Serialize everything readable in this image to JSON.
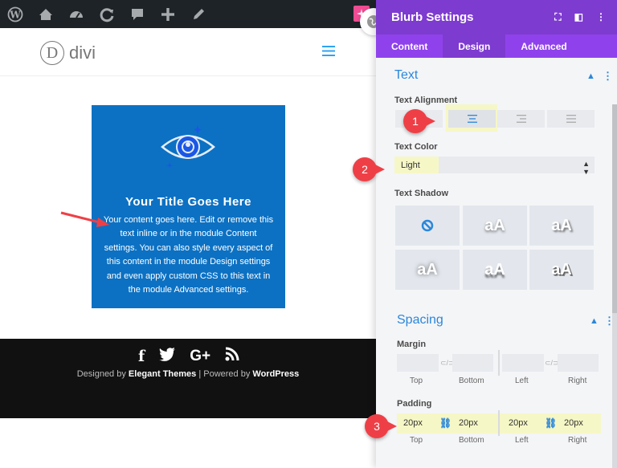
{
  "site": {
    "logo_letter": "D",
    "logo_text": "divi"
  },
  "blurb": {
    "title": "Your Title Goes Here",
    "body": "Your content goes here. Edit or remove this text inline or in the module Content settings. You can also style every aspect of this content in the module Design settings and even apply custom CSS to this text in the module Advanced settings."
  },
  "footer": {
    "social": [
      "f",
      "t",
      "G+",
      "rss"
    ],
    "credits_prefix": "Designed by ",
    "credits_brand": "Elegant Themes",
    "credits_mid": " | Powered by ",
    "credits_wp": "WordPress"
  },
  "panel": {
    "title": "Blurb Settings",
    "tabs": [
      "Content",
      "Design",
      "Advanced"
    ],
    "active_tab": "Design",
    "text_section": {
      "title": "Text",
      "alignment_label": "Text Alignment",
      "color_label": "Text Color",
      "color_value": "Light",
      "shadow_label": "Text Shadow",
      "shadow_preview": "aA"
    },
    "spacing_section": {
      "title": "Spacing",
      "margin_label": "Margin",
      "padding_label": "Padding",
      "side_labels": [
        "Top",
        "Bottom",
        "Left",
        "Right"
      ],
      "padding_values": [
        "20px",
        "20px",
        "20px",
        "20px"
      ]
    }
  },
  "callouts": [
    "1",
    "2",
    "3"
  ],
  "colors": {
    "accent_purple": "#7e3bd0",
    "tab_purple": "#8f42ec",
    "blurb_blue": "#0c71c3",
    "section_blue": "#2b87da",
    "highlight_yellow": "#f6f7c6",
    "callout_red": "#ef3f46"
  }
}
